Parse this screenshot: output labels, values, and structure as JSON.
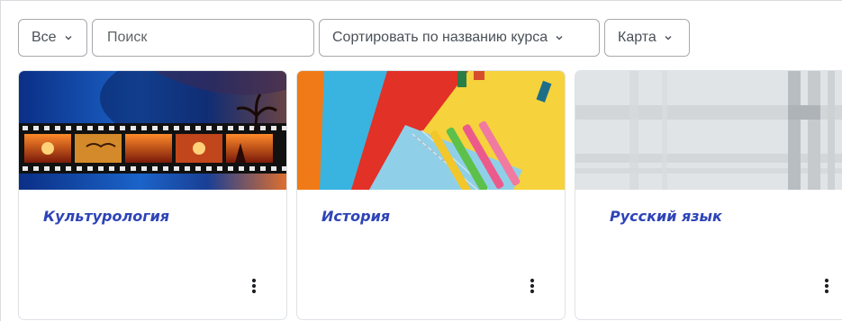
{
  "filters": {
    "grouping": {
      "label": "Все"
    },
    "search": {
      "placeholder": "Поиск",
      "value": ""
    },
    "sort": {
      "label": "Сортировать по названию курса"
    },
    "view": {
      "label": "Карта"
    }
  },
  "courses": [
    {
      "title": "Культурология",
      "image": "film-strip-sunset"
    },
    {
      "title": "История",
      "image": "colored-paper-notebook-markers"
    },
    {
      "title": "Русский язык",
      "image": "gray-plaid-pattern"
    }
  ],
  "colors": {
    "link": "#2e44b8",
    "border": "#a7a9ad",
    "card_border": "#dee2e6"
  },
  "icons": {
    "dropdown": "chevron-down-icon",
    "card_menu": "vertical-ellipsis-icon"
  }
}
